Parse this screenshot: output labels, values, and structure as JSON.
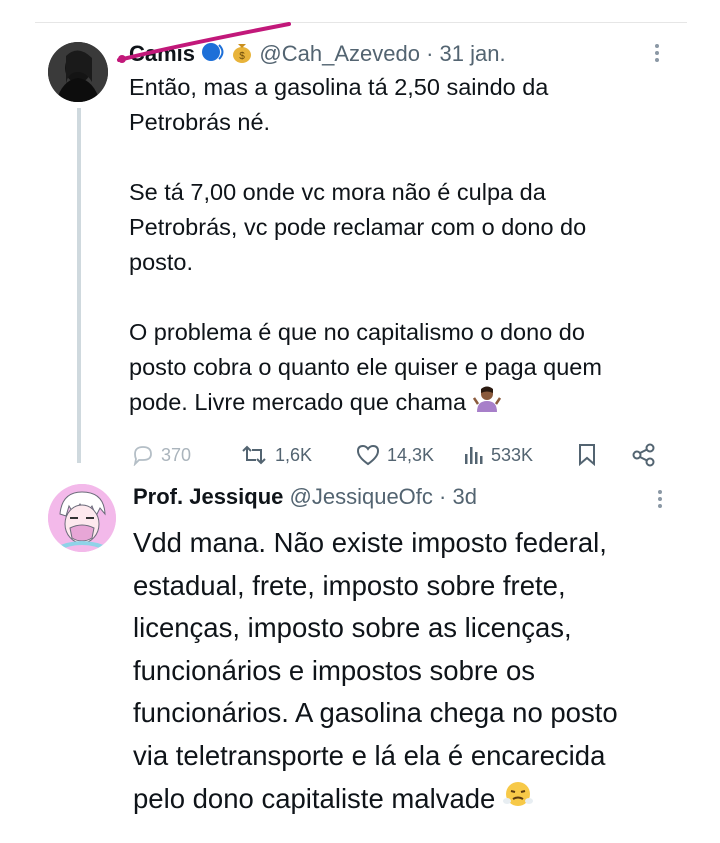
{
  "tweet1": {
    "name": "Camis",
    "handle": "@Cah_Azevedo",
    "separator": "·",
    "date": "31 jan.",
    "text": "Então, mas a gasolina tá 2,50 saindo da\nPetrobrás né.\n\nSe tá 7,00 onde vc mora não é culpa da\nPetrobrás, vc pode reclamar com o dono do\nposto.\n\nO problema é que no capitalismo o dono do\nposto cobra o quanto ele quiser e paga quem\npode. Livre mercado que chama",
    "badges": [
      "speaking-head-emoji",
      "money-bag-emoji"
    ],
    "trailing_emoji": "person-shrugging-emoji",
    "actions": {
      "replies": "370",
      "retweets": "1,6K",
      "likes": "14,3K",
      "views": "533K"
    }
  },
  "tweet2": {
    "name": "Prof. Jessique",
    "handle": "@JessiqueOfc",
    "separator": "·",
    "date": "3d",
    "text": "Vdd mana. Não existe imposto federal,\nestadual, frete, imposto sobre frete,\nlicenças, imposto sobre as licenças,\nfuncionários e impostos sobre os\nfuncionários. A gasolina chega no posto\nvia teletransporte e lá ela é encarecida\npelo dono capitaliste malvade",
    "trailing_emoji": "face-with-steam-emoji"
  },
  "colors": {
    "text": "#0f1419",
    "muted": "#536471",
    "thread_line": "#cfd9de",
    "annotation_stroke": "#c2187a"
  }
}
